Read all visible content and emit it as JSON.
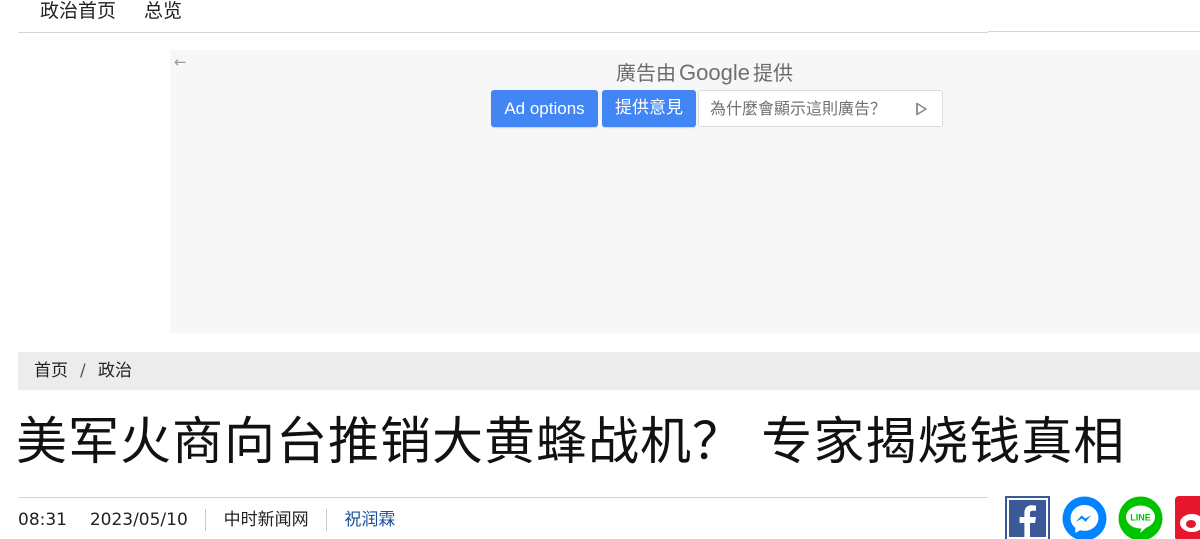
{
  "nav": {
    "home_label": "政治首页",
    "overview_label": "总览"
  },
  "ad": {
    "back_icon": "←",
    "provided_prefix": "廣告由",
    "provided_brand": "Google",
    "provided_suffix": "提供",
    "options_label": "Ad options",
    "feedback_label": "提供意見",
    "why_label": "為什麼會顯示這則廣告？"
  },
  "breadcrumb": {
    "home": "首页",
    "separator": "/",
    "section": "政治"
  },
  "article": {
    "title": "美军火商向台推销大黄蜂战机？ 专家揭烧钱真相",
    "time": "08:31",
    "date": "2023/05/10",
    "source": "中时新闻网",
    "author": "祝润霖"
  },
  "share": {
    "icons": [
      "facebook-icon",
      "messenger-icon",
      "line-icon",
      "weibo-icon"
    ],
    "colors": {
      "facebook": "#3b5998",
      "messenger": "#0084ff",
      "line": "#00c300",
      "weibo": "#e6162d"
    },
    "line_text": "LINE"
  },
  "colors": {
    "accent_blue": "#4285f4",
    "author_link": "#1c4f9c",
    "breadcrumb_bg": "#ececec",
    "ad_bg": "#f7f7f7"
  }
}
